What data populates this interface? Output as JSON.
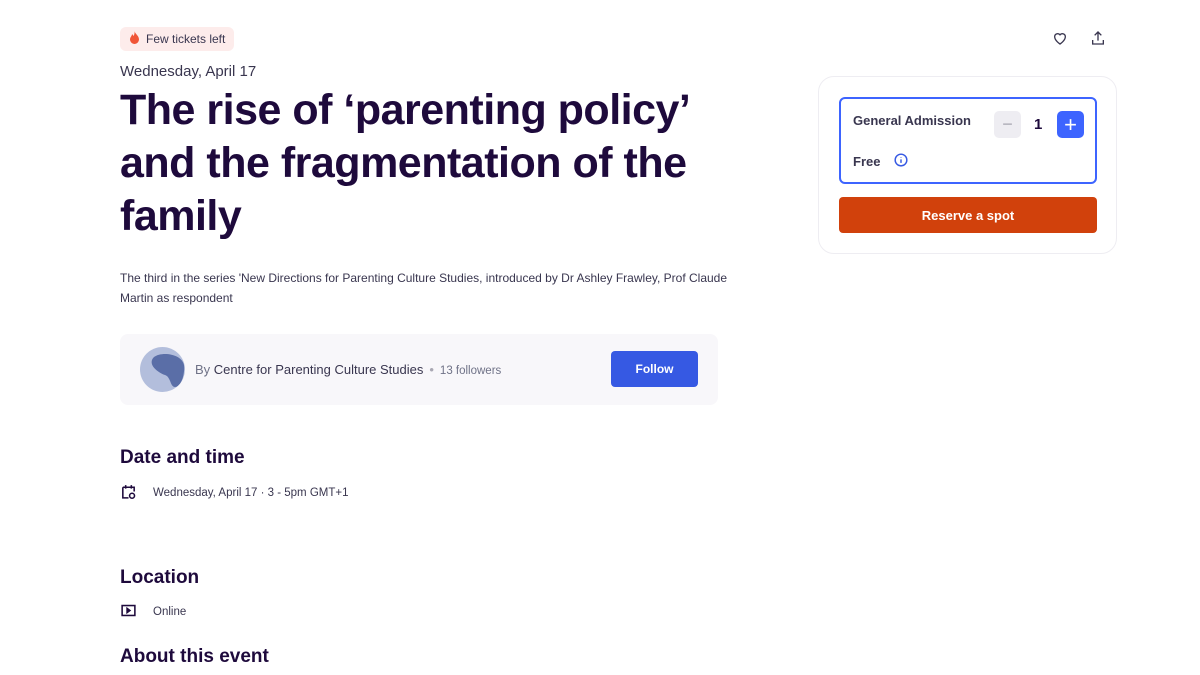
{
  "badge": {
    "label": "Few tickets left",
    "icon": "fire-icon"
  },
  "event": {
    "date": "Wednesday, April 17",
    "title": "The rise of ‘parenting policy’ and the fragmentation of the family",
    "summary": "The third in the series 'New Directions for Parenting Culture Studies, introduced by Dr Ashley Frawley, Prof Claude Martin as respondent"
  },
  "organizer": {
    "by": "By",
    "name": "Centre for Parenting Culture Studies",
    "followers": "13 followers",
    "follow_label": "Follow"
  },
  "sections": {
    "date_time": {
      "heading": "Date and time",
      "value": "Wednesday, April 17 · 3 - 5pm GMT+1"
    },
    "location": {
      "heading": "Location",
      "value": "Online"
    },
    "about": {
      "heading": "About this event"
    }
  },
  "ticket": {
    "name": "General Admission",
    "price": "Free",
    "quantity": "1",
    "reserve_label": "Reserve a spot"
  },
  "colors": {
    "accent": "#3659e3",
    "cta": "#d1410c",
    "text": "#1e0a3c"
  }
}
